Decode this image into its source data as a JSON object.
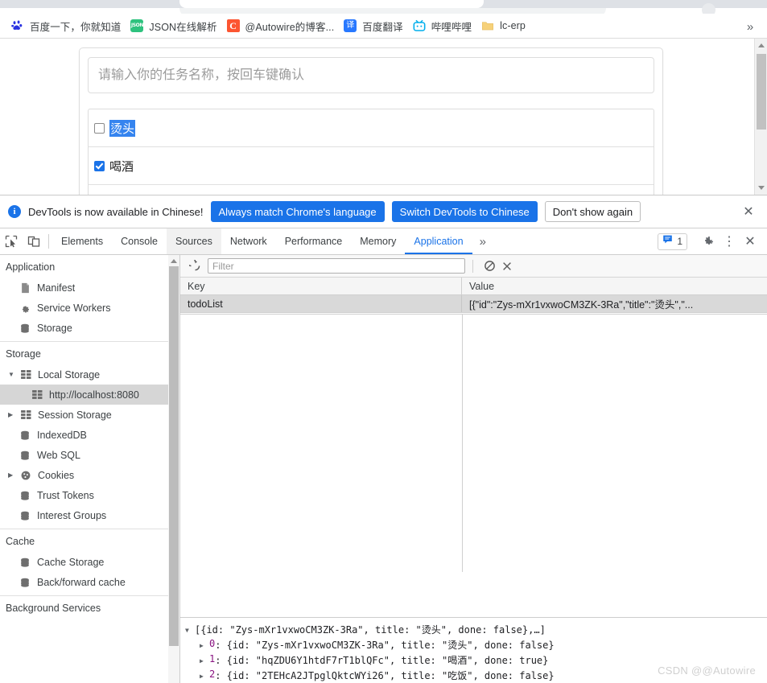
{
  "browser": {
    "bookmarks": [
      {
        "label": "百度一下，你就知道",
        "icon": "baidu-icon"
      },
      {
        "label": "JSON在线解析",
        "icon": "json-icon",
        "icon_text": "JSON"
      },
      {
        "label": "@Autowire的博客...",
        "icon": "csdn-icon",
        "icon_text": "C"
      },
      {
        "label": "百度翻译",
        "icon": "baidu-translate-icon",
        "icon_text": "译"
      },
      {
        "label": "哔哩哔哩",
        "icon": "bilibili-icon"
      },
      {
        "label": "lc-erp",
        "icon": "folder-icon"
      }
    ],
    "overflow_label": "»"
  },
  "page": {
    "todo_input_placeholder": "请输入你的任务名称，按回车键确认",
    "todo_items": [
      {
        "title": "烫头",
        "done": false,
        "selected": true
      },
      {
        "title": "喝酒",
        "done": true,
        "selected": false
      }
    ]
  },
  "devtools": {
    "infobar": {
      "message": "DevTools is now available in Chinese!",
      "primary_button": "Always match Chrome's language",
      "secondary_button": "Switch DevTools to Chinese",
      "tertiary_button": "Don't show again",
      "close_label": "✕"
    },
    "tabs": [
      {
        "label": "Elements",
        "state": "normal"
      },
      {
        "label": "Console",
        "state": "normal"
      },
      {
        "label": "Sources",
        "state": "hovered"
      },
      {
        "label": "Network",
        "state": "normal"
      },
      {
        "label": "Performance",
        "state": "normal"
      },
      {
        "label": "Memory",
        "state": "normal"
      },
      {
        "label": "Application",
        "state": "active"
      }
    ],
    "more_tabs_label": "»",
    "message_count": "1",
    "kebab_label": "⋮",
    "close_label": "✕",
    "sidebar": {
      "sections": [
        {
          "title": "Application",
          "items": [
            {
              "label": "Manifest",
              "icon": "manifest-icon",
              "indent": 1
            },
            {
              "label": "Service Workers",
              "icon": "gear-icon",
              "indent": 1
            },
            {
              "label": "Storage",
              "icon": "database-icon",
              "indent": 1
            }
          ]
        },
        {
          "title": "Storage",
          "items": [
            {
              "label": "Local Storage",
              "icon": "table-icon",
              "indent": 1,
              "twisty": "▼"
            },
            {
              "label": "http://localhost:8080",
              "icon": "table-icon",
              "indent": 2,
              "selected": true
            },
            {
              "label": "Session Storage",
              "icon": "table-icon",
              "indent": 1,
              "twisty": "▶"
            },
            {
              "label": "IndexedDB",
              "icon": "database-icon",
              "indent": 1
            },
            {
              "label": "Web SQL",
              "icon": "database-icon",
              "indent": 1
            },
            {
              "label": "Cookies",
              "icon": "cookie-icon",
              "indent": 1,
              "twisty": "▶"
            },
            {
              "label": "Trust Tokens",
              "icon": "database-icon",
              "indent": 1
            },
            {
              "label": "Interest Groups",
              "icon": "database-icon",
              "indent": 1
            }
          ]
        },
        {
          "title": "Cache",
          "items": [
            {
              "label": "Cache Storage",
              "icon": "database-icon",
              "indent": 1
            },
            {
              "label": "Back/forward cache",
              "icon": "database-icon",
              "indent": 1
            }
          ]
        },
        {
          "title": "Background Services",
          "items": []
        }
      ]
    },
    "storage_panel": {
      "filter_placeholder": "Filter",
      "refresh_label": "refresh-icon",
      "clear_label": "clear-icon",
      "delete_label": "delete-icon",
      "columns": [
        "Key",
        "Value"
      ],
      "rows": [
        {
          "key": "todoList",
          "value": "[{\"id\":\"Zys-mXr1vxwoCM3ZK-3Ra\",\"title\":\"烫头\",\"..."
        }
      ]
    },
    "preview": {
      "root": {
        "twisty": "▼",
        "text": "[{id: \"Zys-mXr1vxwoCM3ZK-3Ra\", title: \"烫头\", done: false},…]"
      },
      "children": [
        {
          "twisty": "▶",
          "index": "0",
          "text": ": {id: \"Zys-mXr1vxwoCM3ZK-3Ra\", title: \"烫头\", done: false}"
        },
        {
          "twisty": "▶",
          "index": "1",
          "text": ": {id: \"hqZDU6Y1htdF7rT1blQFc\", title: \"喝酒\", done: true}"
        },
        {
          "twisty": "▶",
          "index": "2",
          "text": ": {id: \"2TEHcA2JTpglQktcWYi26\", title: \"吃饭\", done: false}"
        }
      ]
    }
  },
  "watermark": "CSDN @@Autowire",
  "colors": {
    "accent_blue": "#1a73e8",
    "selection_blue": "#3584ef",
    "sidebar_selected": "#d6d6d6",
    "row_selected": "#d9d9d9"
  }
}
